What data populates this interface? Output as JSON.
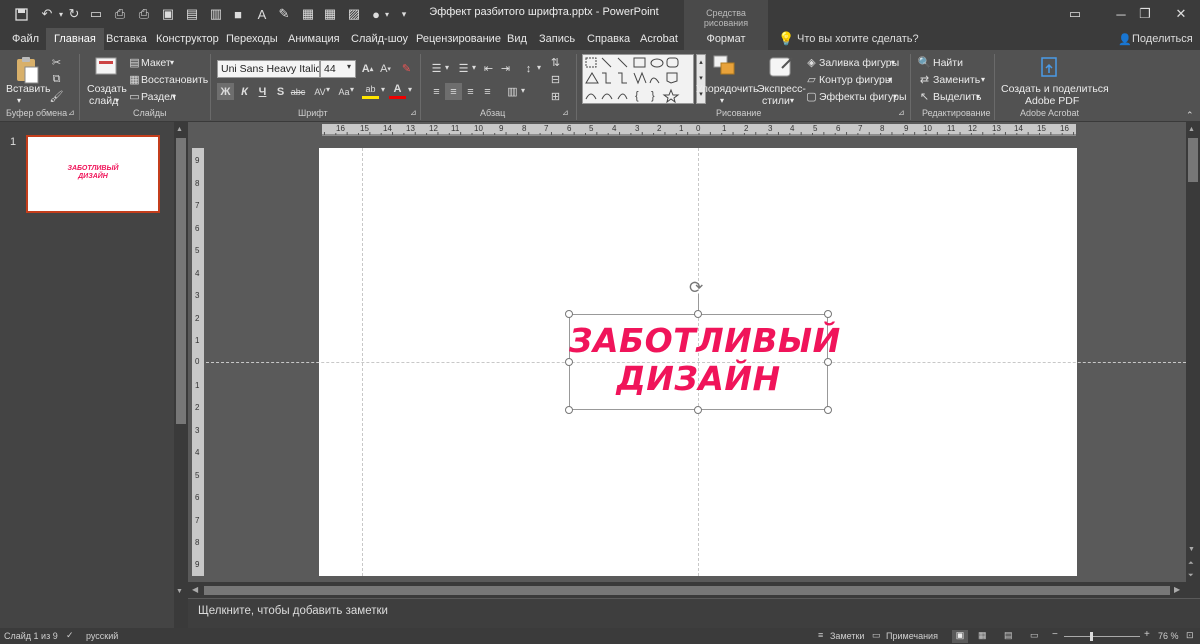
{
  "window": {
    "title": "Эффект разбитого шрифта.pptx  -  PowerPoint",
    "contextual_tab_group": "Средства рисования"
  },
  "tabs": [
    "Файл",
    "Главная",
    "Вставка",
    "Конструктор",
    "Переходы",
    "Анимация",
    "Слайд-шоу",
    "Рецензирование",
    "Вид",
    "Запись",
    "Справка",
    "Acrobat",
    "Формат"
  ],
  "active_tab": "Главная",
  "tell_me": "Что вы хотите сделать?",
  "share": "Поделиться",
  "ribbon": {
    "clipboard": {
      "paste": "Вставить",
      "group": "Буфер обмена"
    },
    "slides": {
      "new_slide_line1": "Создать",
      "new_slide_line2": "слайд",
      "layout": "Макет",
      "reset": "Восстановить",
      "section": "Раздел",
      "group": "Слайды"
    },
    "font": {
      "font_name": "Uni Sans Heavy Italic C",
      "font_size": "44",
      "bold": "Ж",
      "italic": "К",
      "underline": "Ч",
      "shadow": "S",
      "strike": "abc",
      "spacing": "AV",
      "case": "Aa",
      "group": "Шрифт"
    },
    "paragraph": {
      "group": "Абзац"
    },
    "drawing": {
      "arrange": "Упорядочить",
      "quick_styles_line1": "Экспресс-",
      "quick_styles_line2": "стили",
      "fill": "Заливка фигуры",
      "outline": "Контур фигуры",
      "effects": "Эффекты фигуры",
      "group": "Рисование"
    },
    "editing": {
      "find": "Найти",
      "replace": "Заменить",
      "select": "Выделить",
      "group": "Редактирование"
    },
    "acrobat": {
      "create_line1": "Создать и поделиться",
      "create_line2": "Adobe PDF",
      "group": "Adobe Acrobat"
    }
  },
  "thumbnail": {
    "number": "1",
    "text_line1": "ЗАБОТЛИВЫЙ",
    "text_line2": "ДИЗАЙН"
  },
  "slide": {
    "text_line1": "ЗАБОТЛИВЫЙ",
    "text_line2": "ДИЗАЙН",
    "text_color": "#f0145a"
  },
  "ruler": {
    "h_ticks": [
      "16",
      "15",
      "14",
      "13",
      "12",
      "11",
      "10",
      "9",
      "8",
      "7",
      "6",
      "5",
      "4",
      "3",
      "2",
      "1",
      "0",
      "1",
      "2",
      "3",
      "4",
      "5",
      "6",
      "7",
      "8",
      "9",
      "10",
      "11",
      "12",
      "13",
      "14",
      "15",
      "16"
    ],
    "v_ticks": [
      "9",
      "8",
      "7",
      "6",
      "5",
      "4",
      "3",
      "2",
      "1",
      "0",
      "1",
      "2",
      "3",
      "4",
      "5",
      "6",
      "7",
      "8",
      "9"
    ]
  },
  "notes_placeholder": "Щелкните, чтобы добавить заметки",
  "status": {
    "slide_info": "Слайд 1 из 9",
    "language": "русский",
    "notes": "Заметки",
    "comments": "Примечания",
    "zoom": "76 %"
  },
  "colors": {
    "accent": "#c43e1c",
    "brand_text": "#f0145a"
  }
}
